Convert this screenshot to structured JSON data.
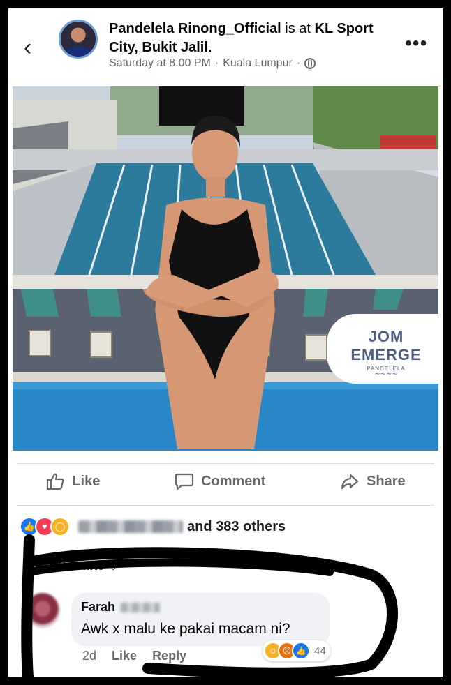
{
  "post": {
    "author": "Pandelela Rinong_Official",
    "connector": "is at",
    "location": "KL Sport City, Bukit Jalil.",
    "time": "Saturday at 8:00 PM",
    "separator": "·",
    "city": "Kuala Lumpur",
    "privacy_icon": "globe-icon",
    "more_icon": "more-icon"
  },
  "brand": {
    "line1": "JOM",
    "line2": "EMERGE",
    "line3": "PANDELELA"
  },
  "actions": {
    "like": "Like",
    "comment": "Comment",
    "share": "Share"
  },
  "reactions": {
    "icons": [
      "like-icon",
      "love-icon",
      "wow-icon"
    ],
    "summary": "and 383 others"
  },
  "comments": {
    "filter": "Most Relevant",
    "filter_visible": "elevant",
    "items": [
      {
        "name": "Farah",
        "text": "Awk x malu ke pakai macam ni?",
        "age": "2d",
        "like": "Like",
        "reply": "Reply",
        "reaction_count": "44"
      }
    ]
  },
  "colors": {
    "accent": "#1877f2",
    "annotation": "#000000",
    "brand": "#4d5f80"
  }
}
